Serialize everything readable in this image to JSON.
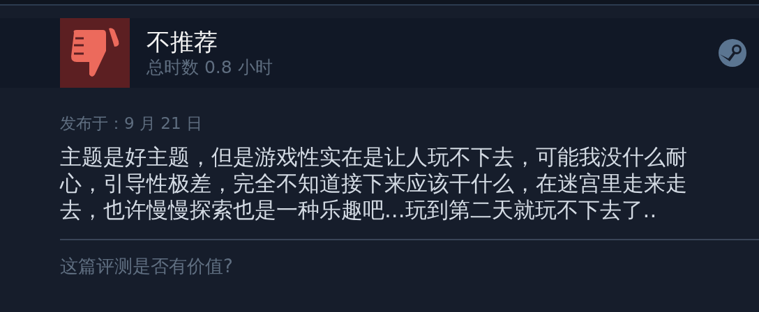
{
  "review": {
    "verdict": "不推荐",
    "recommended": false,
    "playtime": "总时数 0.8 小时",
    "posted": "发布于：9 月 21 日",
    "text": "主题是好主题，但是游戏性实在是让人玩不下去，可能我没什么耐心，引导性极差，完全不知道接下来应该干什么，在迷宫里走来走去，也许慢慢探索也是一种乐趣吧...玩到第二天就玩不下去了..",
    "helpful_prompt": "这篇评测是否有价值?"
  }
}
